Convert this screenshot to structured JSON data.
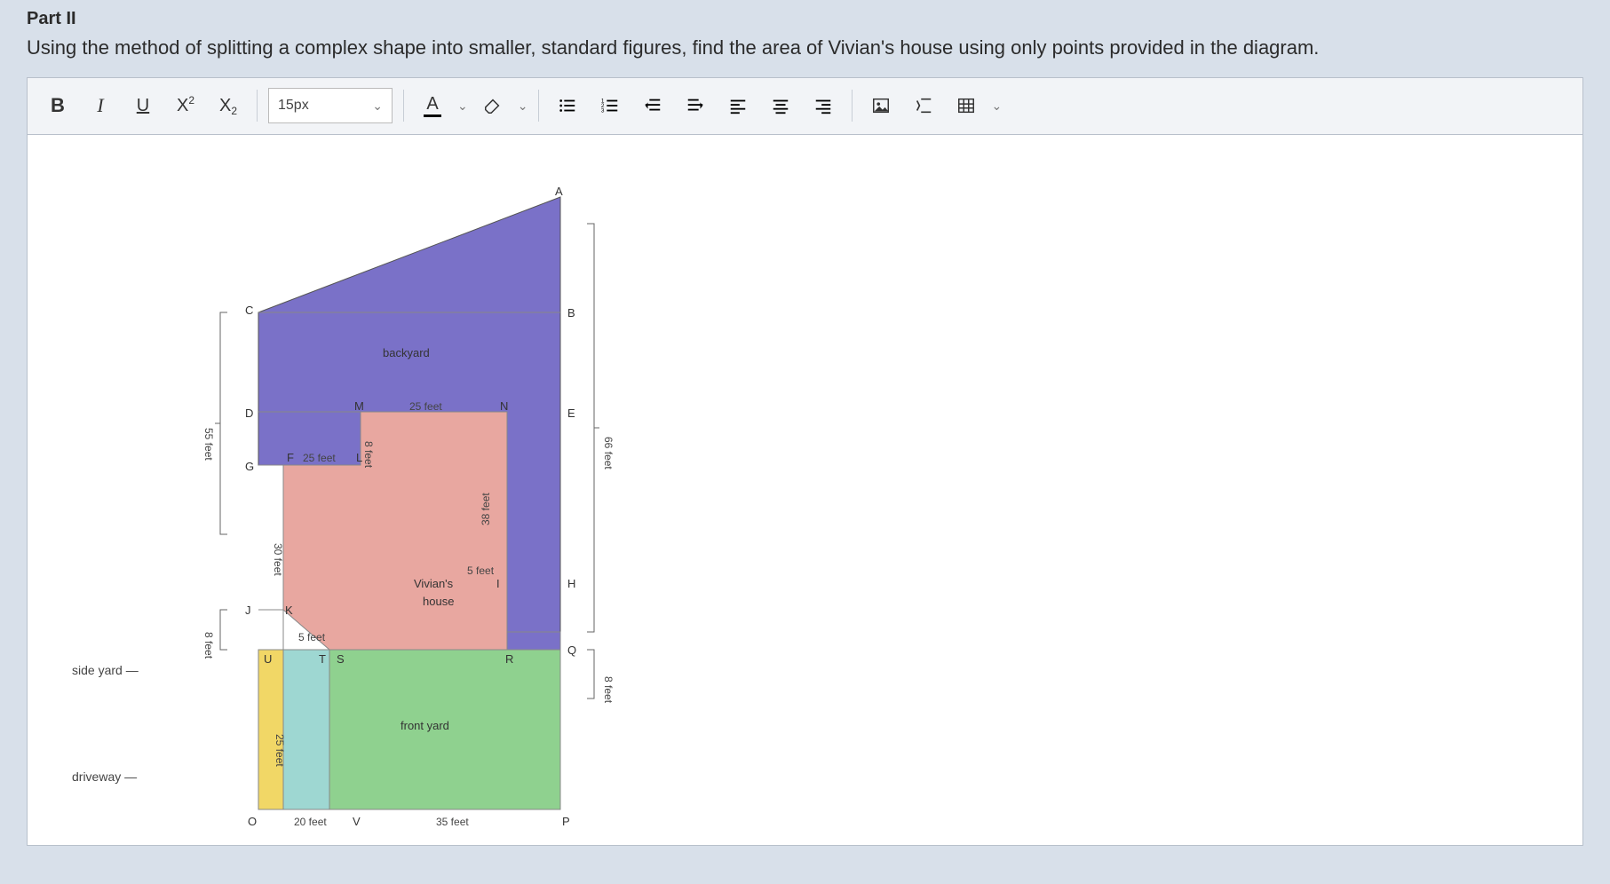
{
  "header": {
    "part": "Part II"
  },
  "question": "Using the method of splitting a complex shape into smaller, standard figures, find the area of Vivian's house using only points provided in the diagram.",
  "toolbar": {
    "fontSize": "15px",
    "fontColorLabel": "A"
  },
  "diagram": {
    "labels": {
      "backyard": "backyard",
      "frontyard": "front yard",
      "sideyard": "side yard",
      "driveway": "driveway",
      "house_l1": "Vivian's",
      "house_l2": "house"
    },
    "points": {
      "A": "A",
      "B": "B",
      "C": "C",
      "D": "D",
      "E": "E",
      "F": "F",
      "G": "G",
      "H": "H",
      "I": "I",
      "J": "J",
      "K": "K",
      "L": "L",
      "M": "M",
      "N": "N",
      "O": "O",
      "P": "P",
      "Q": "Q",
      "R": "R",
      "S": "S",
      "T": "T",
      "U": "U",
      "V": "V"
    },
    "dims": {
      "d55": "55 feet",
      "d8L": "8 feet",
      "d30": "30 feet",
      "d25F": "25 feet",
      "d25M": "25 feet",
      "d8ML": "8 feet",
      "d38": "38 feet",
      "d5feet": "5 feet",
      "d5tri": "5 feet",
      "d25U": "25 feet",
      "d20": "20 feet",
      "d35": "35 feet",
      "d66": "66 feet",
      "d8R": "8 feet"
    }
  },
  "chart_data": {
    "type": "diagram",
    "title": "Property plan split into labeled regions",
    "units": "feet",
    "points_xy": {
      "A": [
        55,
        121
      ],
      "B": [
        55,
        91
      ],
      "C": [
        0,
        91
      ],
      "D": [
        0,
        66
      ],
      "E": [
        55,
        66
      ],
      "F": [
        5,
        55
      ],
      "G": [
        0,
        55
      ],
      "H": [
        55,
        33
      ],
      "I": [
        50,
        33
      ],
      "J": [
        0,
        25
      ],
      "K": [
        5,
        25
      ],
      "L": [
        30,
        55
      ],
      "M": [
        30,
        66
      ],
      "N": [
        55,
        66
      ],
      "O": [
        0,
        0
      ],
      "P": [
        55,
        0
      ],
      "Q": [
        55,
        25
      ],
      "R": [
        50,
        25
      ],
      "S": [
        25,
        25
      ],
      "T": [
        20,
        25
      ],
      "U": [
        5,
        25
      ],
      "V": [
        20,
        0
      ]
    },
    "segments": [
      {
        "from": "C",
        "to": "D",
        "length": 55,
        "label": "55 feet"
      },
      {
        "from": "J",
        "to": "O",
        "length": 8,
        "label": "8 feet (left lower bracket)"
      },
      {
        "from": "F",
        "to": "K",
        "length": 30,
        "label": "30 feet"
      },
      {
        "from": "F",
        "to": "L",
        "length": 25,
        "label": "25 feet"
      },
      {
        "from": "M",
        "to": "N",
        "length": 25,
        "label": "25 feet"
      },
      {
        "from": "M",
        "to": "L",
        "length": 8,
        "label": "8 feet"
      },
      {
        "from": "N",
        "to": "I",
        "length": 38,
        "label": "38 feet (vertical, approx)"
      },
      {
        "from": "I",
        "to": "R",
        "length": 5,
        "label": "5 feet (vertical near I)"
      },
      {
        "from": "K",
        "to": "T",
        "length": 5,
        "label": "5 feet (triangle hypotenuse label)"
      },
      {
        "from": "U",
        "to": null,
        "length": 25,
        "label": "25 feet (driveway height)"
      },
      {
        "from": "O",
        "to": "V",
        "length": 20,
        "label": "20 feet"
      },
      {
        "from": "V",
        "to": "P",
        "length": 35,
        "label": "35 feet"
      },
      {
        "from": "E",
        "to": "P",
        "length": 66,
        "label": "66 feet (right bracket upper)"
      },
      {
        "from": "Q",
        "to": "P",
        "length": 8,
        "label": "8 feet (right bracket lower)"
      }
    ],
    "regions": [
      {
        "name": "backyard",
        "color": "#7a71c8"
      },
      {
        "name": "house",
        "color": "#e8a7a0"
      },
      {
        "name": "front yard",
        "color": "#7cc97c"
      },
      {
        "name": "side yard",
        "color": "#9ed7d2"
      },
      {
        "name": "driveway",
        "color": "#f1d766"
      }
    ]
  }
}
